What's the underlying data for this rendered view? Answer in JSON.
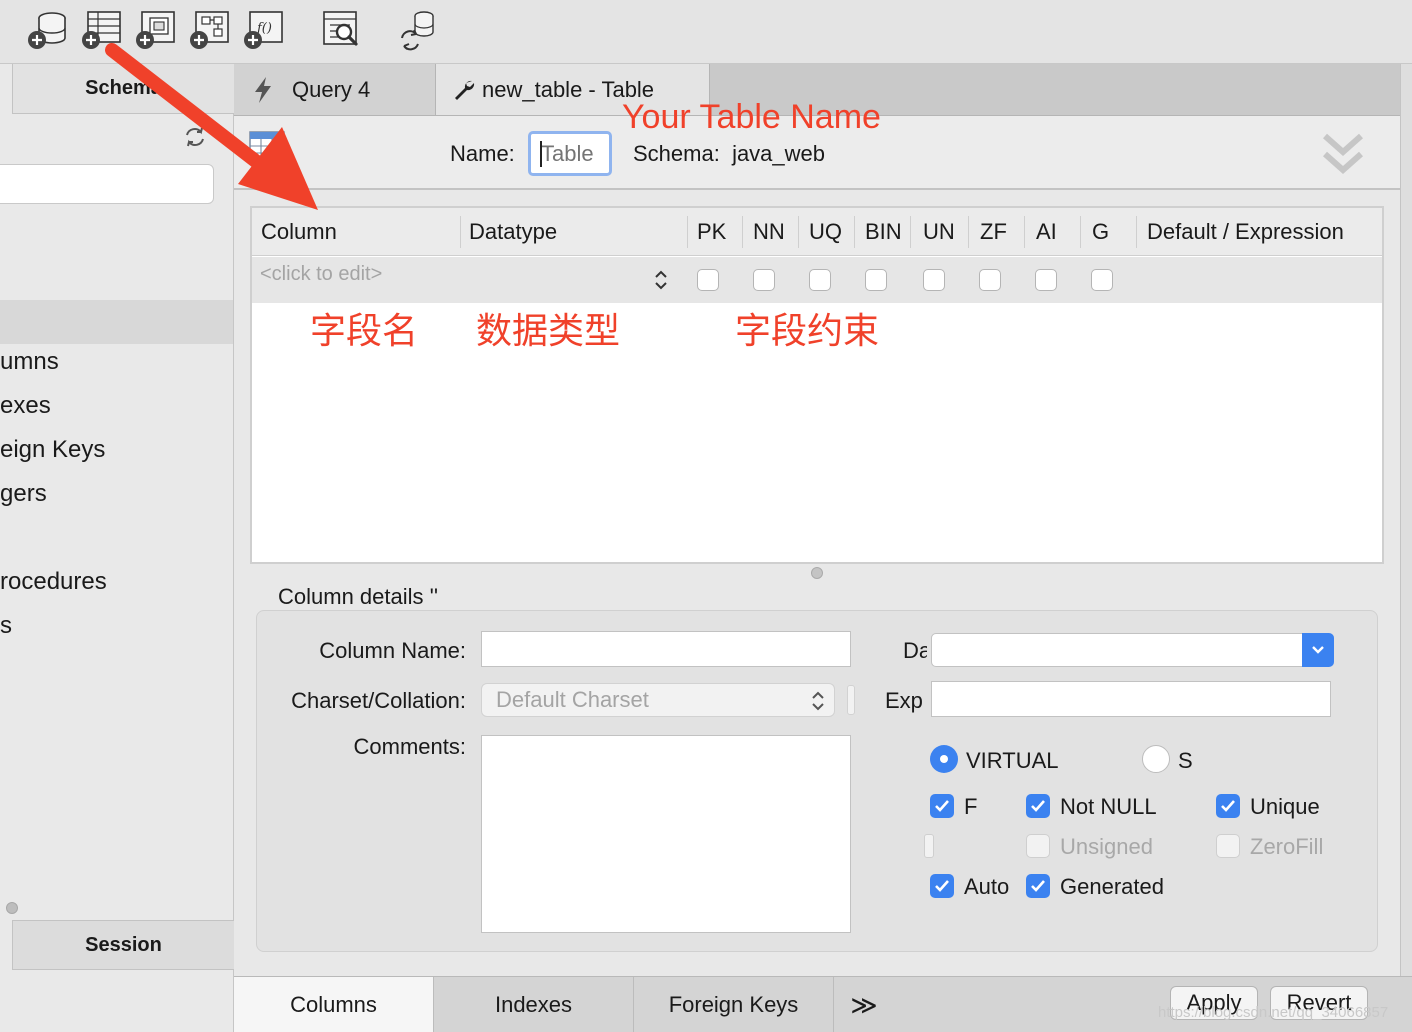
{
  "toolbar": {
    "icons": [
      "new-schema-icon",
      "new-table-icon",
      "new-view-icon",
      "new-procedure-icon",
      "new-function-icon",
      "table-inspector-icon",
      "reconnect-icon"
    ]
  },
  "sidebar": {
    "schemas_tab": "Schema",
    "items": [
      "umns",
      "exes",
      "eign Keys",
      "gers",
      "rocedures",
      "s"
    ],
    "session_tab": "Session"
  },
  "tabs": {
    "query": "Query 4",
    "table": "new_table - Table"
  },
  "editor": {
    "annotation_title": "Your Table Name",
    "name_label": "Name:",
    "name_placeholder": "Table",
    "schema_label": "Schema:",
    "schema_value": "java_web"
  },
  "grid": {
    "headers": {
      "column": "Column",
      "datatype": "Datatype",
      "pk": "PK",
      "nn": "NN",
      "uq": "UQ",
      "bin": "BIN",
      "un": "UN",
      "zf": "ZF",
      "ai": "AI",
      "g": "G",
      "default": "Default / Expression"
    },
    "click_to_edit": "<click to edit>",
    "annotations": {
      "field_name": "字段名",
      "data_type": "数据类型",
      "constraints": "字段约束"
    }
  },
  "details": {
    "title": "Column details ''",
    "column_name_label": "Column Name:",
    "charset_label": "Charset/Collation:",
    "charset_value": "Default Charset",
    "comments_label": "Comments:",
    "datatype_label": "Da",
    "expression_label": "Exp",
    "virtual_label": "VIRTUAL",
    "stored_label": "S",
    "pk_label": "F",
    "not_null_label": "Not NULL",
    "unique_label": "Unique",
    "unsigned_label": "Unsigned",
    "zerofill_label": "ZeroFill",
    "auto_label": "Auto",
    "generated_label": "Generated"
  },
  "bottom_tabs": {
    "columns": "Columns",
    "indexes": "Indexes",
    "foreign_keys": "Foreign Keys",
    "more": "≫"
  },
  "actions": {
    "apply": "Apply",
    "revert": "Revert"
  },
  "watermark": "https://blog.csdn.net/qq_34066857",
  "colors": {
    "annotation": "#f0412a",
    "accent": "#3b82f0"
  }
}
